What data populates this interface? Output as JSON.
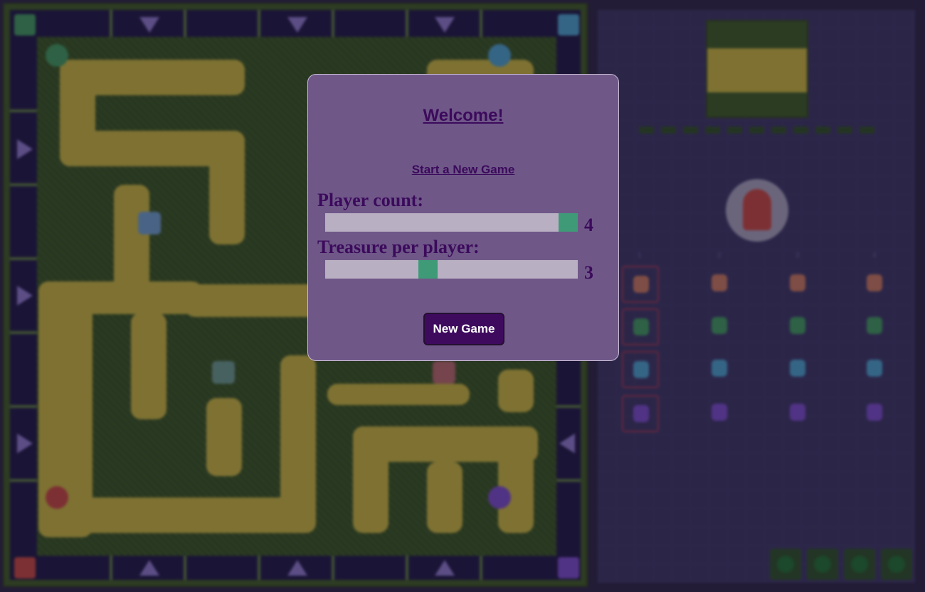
{
  "modal": {
    "title": "Welcome!",
    "subtitle": "Start a New Game",
    "player_count": {
      "label": "Player count:",
      "value": "4",
      "min": 2,
      "max": 4,
      "fraction": 1.0
    },
    "treasure_per_player": {
      "label": "Treasure per player:",
      "value": "3",
      "fraction": 0.4
    },
    "new_game_button": "New Game"
  },
  "board": {
    "pieces": [
      {
        "name": "green-pawn-icon",
        "color": "#3f9a5a"
      },
      {
        "name": "blue-pawn-icon",
        "color": "#4aa0c8"
      },
      {
        "name": "red-pawn-icon",
        "color": "#c6463c"
      },
      {
        "name": "purple-pawn-icon",
        "color": "#7a4ac8"
      }
    ],
    "shift_arrow_icon": "triangle-arrow-icon"
  },
  "side_panel": {
    "current_player_icon": "red-pawn-icon",
    "column_numbers": [
      "1",
      "2",
      "3",
      "4"
    ],
    "control_icons": [
      "rotate-left-icon",
      "rotate-right-icon",
      "undo-icon",
      "confirm-icon"
    ]
  },
  "colors": {
    "modal_bg": "#6f5888",
    "accent_text": "#3c0a5c",
    "slider_thumb": "#3f9a78",
    "slider_track": "#b8afc2",
    "button_bg": "#3e0a5e"
  }
}
